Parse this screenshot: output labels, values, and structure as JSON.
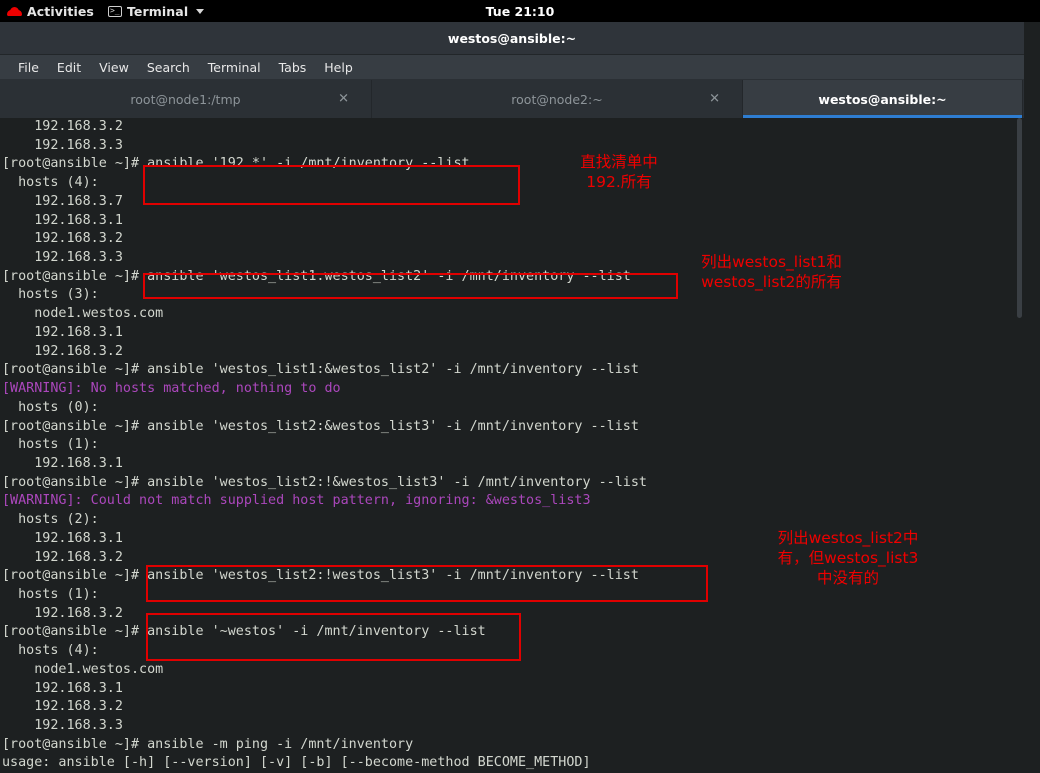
{
  "topbar": {
    "activities_label": "Activities",
    "app_label": "Terminal",
    "clock": "Tue 21:10",
    "redhat_icon": "redhat-logo-icon",
    "terminal_icon": "terminal-icon",
    "caret_icon": "chevron-down-icon"
  },
  "window": {
    "title": "westos@ansible:~"
  },
  "menubar": {
    "items": [
      {
        "label": "File"
      },
      {
        "label": "Edit"
      },
      {
        "label": "View"
      },
      {
        "label": "Search"
      },
      {
        "label": "Terminal"
      },
      {
        "label": "Tabs"
      },
      {
        "label": "Help"
      }
    ]
  },
  "tabs": [
    {
      "label": "root@node1:/tmp",
      "active": false,
      "close_icon": "close-icon"
    },
    {
      "label": "root@node2:~",
      "active": false,
      "close_icon": "close-icon"
    },
    {
      "label": "westos@ansible:~",
      "active": true,
      "close_icon": ""
    }
  ],
  "terminal": {
    "lines": [
      {
        "text": "    192.168.3.2",
        "warn": false
      },
      {
        "text": "    192.168.3.3",
        "warn": false
      },
      {
        "text": "[root@ansible ~]# ansible '192.*' -i /mnt/inventory --list",
        "warn": false
      },
      {
        "text": "  hosts (4):",
        "warn": false
      },
      {
        "text": "    192.168.3.7",
        "warn": false
      },
      {
        "text": "    192.168.3.1",
        "warn": false
      },
      {
        "text": "    192.168.3.2",
        "warn": false
      },
      {
        "text": "    192.168.3.3",
        "warn": false
      },
      {
        "text": "[root@ansible ~]# ansible 'westos_list1:westos_list2' -i /mnt/inventory --list",
        "warn": false
      },
      {
        "text": "  hosts (3):",
        "warn": false
      },
      {
        "text": "    node1.westos.com",
        "warn": false
      },
      {
        "text": "    192.168.3.1",
        "warn": false
      },
      {
        "text": "    192.168.3.2",
        "warn": false
      },
      {
        "text": "[root@ansible ~]# ansible 'westos_list1:&westos_list2' -i /mnt/inventory --list",
        "warn": false
      },
      {
        "text": "[WARNING]: No hosts matched, nothing to do",
        "warn": true
      },
      {
        "text": "  hosts (0):",
        "warn": false
      },
      {
        "text": "[root@ansible ~]# ansible 'westos_list2:&westos_list3' -i /mnt/inventory --list",
        "warn": false
      },
      {
        "text": "  hosts (1):",
        "warn": false
      },
      {
        "text": "    192.168.3.1",
        "warn": false
      },
      {
        "text": "[root@ansible ~]# ansible 'westos_list2:!&westos_list3' -i /mnt/inventory --list",
        "warn": false
      },
      {
        "text": "[WARNING]: Could not match supplied host pattern, ignoring: &westos_list3",
        "warn": true
      },
      {
        "text": "  hosts (2):",
        "warn": false
      },
      {
        "text": "    192.168.3.1",
        "warn": false
      },
      {
        "text": "    192.168.3.2",
        "warn": false
      },
      {
        "text": "[root@ansible ~]# ansible 'westos_list2:!westos_list3' -i /mnt/inventory --list",
        "warn": false
      },
      {
        "text": "  hosts (1):",
        "warn": false
      },
      {
        "text": "    192.168.3.2",
        "warn": false
      },
      {
        "text": "[root@ansible ~]# ansible '~westos' -i /mnt/inventory --list",
        "warn": false
      },
      {
        "text": "  hosts (4):",
        "warn": false
      },
      {
        "text": "    node1.westos.com",
        "warn": false
      },
      {
        "text": "    192.168.3.1",
        "warn": false
      },
      {
        "text": "    192.168.3.2",
        "warn": false
      },
      {
        "text": "    192.168.3.3",
        "warn": false
      },
      {
        "text": "[root@ansible ~]# ansible -m ping -i /mnt/inventory",
        "warn": false
      },
      {
        "text": "usage: ansible [-h] [--version] [-v] [-b] [--become-method BECOME_METHOD]",
        "warn": false
      }
    ]
  },
  "annotations": {
    "accent_color": "#ee0000",
    "notes": [
      {
        "text": "直找清单中\n192.所有"
      },
      {
        "text": "列出westos_list1和\nwestos_list2的所有"
      },
      {
        "text": "列出westos_list2中\n有，但westos_list3\n中没有的"
      }
    ],
    "boxes": [
      {
        "name": "highlight-box-cmd-192"
      },
      {
        "name": "highlight-box-cmd-union"
      },
      {
        "name": "highlight-box-cmd-exclude"
      },
      {
        "name": "highlight-box-cmd-regex"
      }
    ]
  }
}
